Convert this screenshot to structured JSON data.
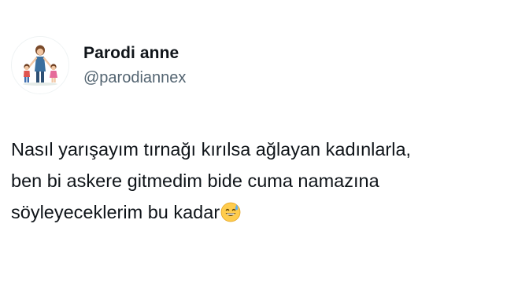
{
  "tweet": {
    "author": {
      "display_name": "Parodi anne",
      "handle": "@parodiannex",
      "avatar_icon": "mother-with-children-avatar-icon"
    },
    "text_lines": [
      "Nasıl yarışayım tırnağı kırılsa ağlayan kadınlarla,",
      "ben bi askere gitmedim bide cuma namazına",
      "söyleyeceklerim bu kadar"
    ],
    "trailing_emoji": "grinning-face-with-sweat-icon"
  }
}
